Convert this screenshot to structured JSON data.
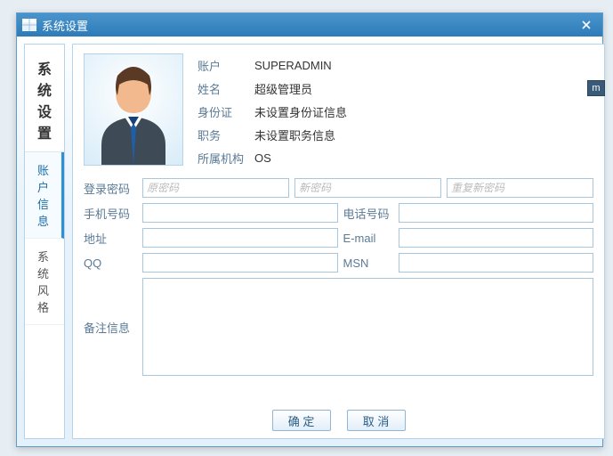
{
  "window": {
    "title": "系统设置"
  },
  "sidebar": {
    "heading": "系统设置",
    "items": [
      {
        "label": "账户信息",
        "active": true
      },
      {
        "label": "系统风格",
        "active": false
      }
    ]
  },
  "info": {
    "rows": [
      {
        "label": "账户",
        "value": "SUPERADMIN"
      },
      {
        "label": "姓名",
        "value": "超级管理员"
      },
      {
        "label": "身份证",
        "value": "未设置身份证信息"
      },
      {
        "label": "职务",
        "value": "未设置职务信息"
      },
      {
        "label": "所属机构",
        "value": "OS"
      }
    ]
  },
  "form": {
    "login_pw_label": "登录密码",
    "pw_old_ph": "原密码",
    "pw_new_ph": "新密码",
    "pw_repeat_ph": "重复新密码",
    "mobile_label": "手机号码",
    "phone_label": "电话号码",
    "address_label": "地址",
    "email_label": "E-mail",
    "qq_label": "QQ",
    "msn_label": "MSN",
    "remarks_label": "备注信息",
    "mobile_value": "",
    "phone_value": "",
    "address_value": "",
    "email_value": "",
    "qq_value": "",
    "msn_value": "",
    "remarks_value": ""
  },
  "buttons": {
    "ok": "确 定",
    "cancel": "取 消"
  },
  "side_badge": "m"
}
